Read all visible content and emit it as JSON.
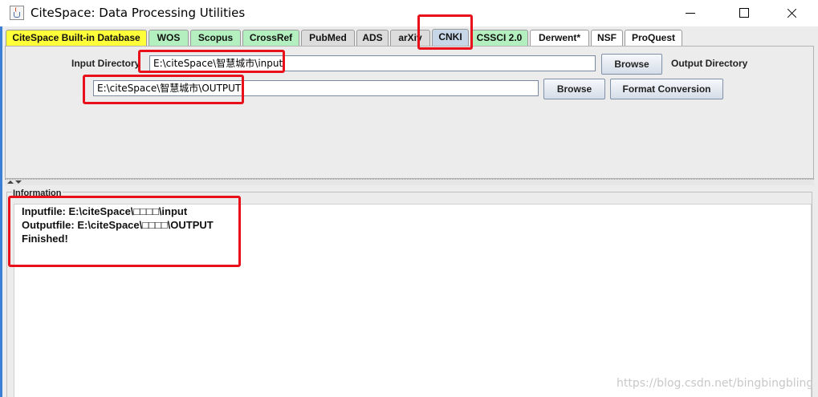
{
  "window": {
    "title": "CiteSpace: Data Processing Utilities",
    "minimize_label": "",
    "maximize_label": "",
    "close_label": ""
  },
  "tabs": [
    {
      "label": "CiteSpace Built-in Database",
      "color": "#ffff3a"
    },
    {
      "label": "WOS",
      "color": "#b4f0bf"
    },
    {
      "label": "Scopus",
      "color": "#b4f0bf"
    },
    {
      "label": "CrossRef",
      "color": "#b4f0bf"
    },
    {
      "label": "PubMed",
      "color": "#dcdcdc"
    },
    {
      "label": "ADS",
      "color": "#dcdcdc"
    },
    {
      "label": "arXiv",
      "color": "#dcdcdc"
    },
    {
      "label": "CNKI",
      "color": "#c8d7e8",
      "selected": true
    },
    {
      "label": "CSSCI 2.0",
      "color": "#b4f0bf"
    },
    {
      "label": "Derwent*",
      "color": "#ffffff"
    },
    {
      "label": "NSF",
      "color": "#ffffff"
    },
    {
      "label": "ProQuest",
      "color": "#ffffff"
    }
  ],
  "form": {
    "input_directory_label": "Input Directory",
    "input_directory_value": "E:\\citeSpace\\智慧城市\\input",
    "browse_input_label": "Browse",
    "output_directory_label": "Output Directory",
    "output_directory_value": "E:\\citeSpace\\智慧城市\\OUTPUT",
    "browse_output_label": "Browse",
    "format_conversion_label": "Format Conversion"
  },
  "information": {
    "title": "Information",
    "lines": [
      "Inputfile: E:\\citeSpace\\□□□□\\input",
      "Outputfile: E:\\citeSpace\\□□□□\\OUTPUT",
      "Finished!"
    ]
  },
  "watermark": "https://blog.csdn.net/bingbingbling",
  "colors": {
    "highlight": "#e8101a",
    "window_border": "#3b7fd6"
  }
}
